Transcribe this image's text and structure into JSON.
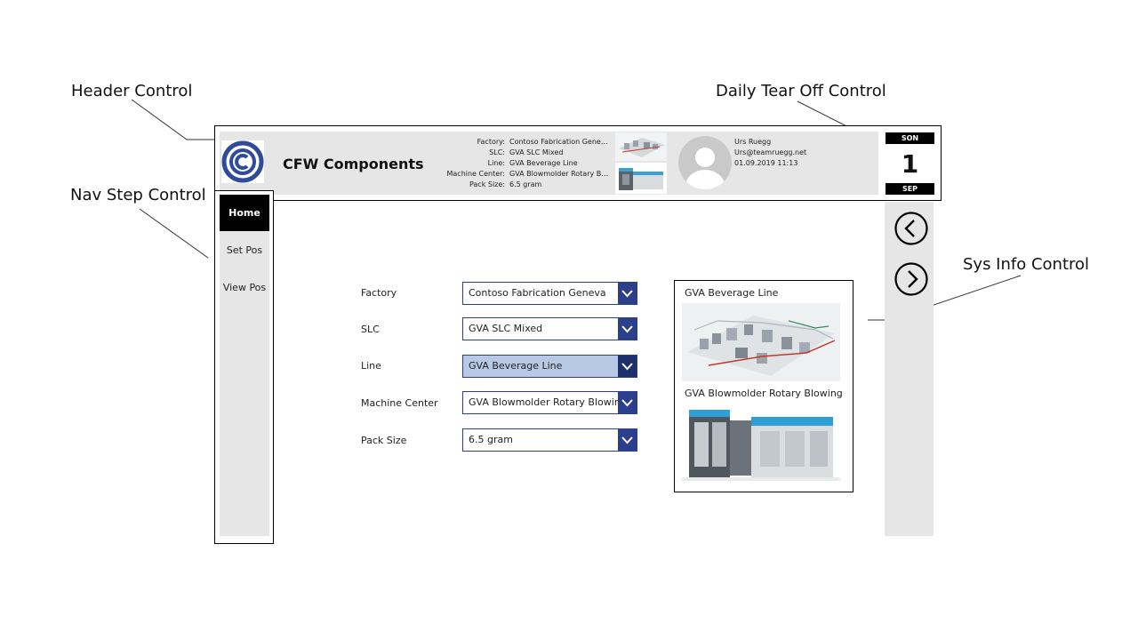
{
  "callouts": {
    "header": "Header Control",
    "tear_off": "Daily Tear Off Control",
    "nav_step": "Nav Step Control",
    "sys_info": "Sys Info Control"
  },
  "header": {
    "app_title": "CFW Components",
    "info_labels": [
      "Factory:",
      "SLC:",
      "Line:",
      "Machine Center:",
      "Pack Size:"
    ],
    "info_values": [
      "Contoso Fabrication Geneva",
      "GVA SLC Mixed",
      "GVA Beverage Line",
      "GVA Blowmolder Rotary Blo...",
      "6.5 gram"
    ],
    "user": {
      "name": "Urs Ruegg",
      "email": "Urs@teamruegg.net",
      "datetime": "01.09.2019 11:13"
    }
  },
  "tear_off": {
    "weekday": "SON",
    "day": "1",
    "month": "SEP"
  },
  "nav": {
    "items": [
      "Home",
      "Set Pos",
      "View Pos"
    ],
    "active": "Home"
  },
  "form": {
    "fields": [
      {
        "label": "Factory",
        "value": "Contoso Fabrication Geneva"
      },
      {
        "label": "SLC",
        "value": "GVA SLC Mixed"
      },
      {
        "label": "Line",
        "value": "GVA Beverage Line"
      },
      {
        "label": "Machine Center",
        "value": "GVA Blowmolder Rotary Blowing Sy"
      },
      {
        "label": "Pack Size",
        "value": "6.5 gram"
      }
    ],
    "selected_field": "Line"
  },
  "sys_info": {
    "line_title": "GVA Beverage Line",
    "machine_title": "GVA Blowmolder Rotary Blowing S..."
  },
  "colors": {
    "accent": "#2b3f8c",
    "selected_bg": "#b8c9e6",
    "panel_bg": "#e6e6e6",
    "logo_blue": "#2f4b9a"
  },
  "icons": {
    "logo": "company-logo-icon",
    "avatar": "user-avatar-icon",
    "prev": "chevron-left-circle-icon",
    "next": "chevron-right-circle-icon",
    "dropdown": "chevron-down-icon"
  }
}
